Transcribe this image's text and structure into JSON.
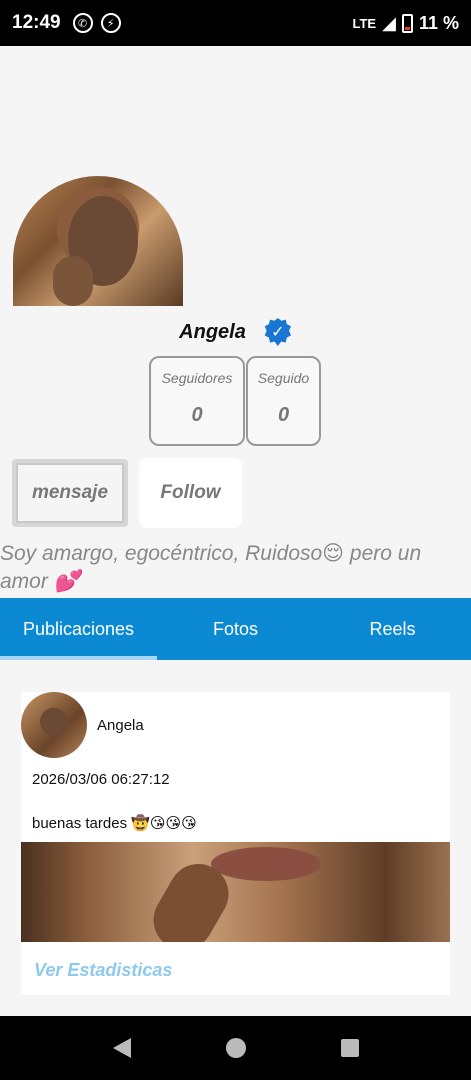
{
  "status_bar": {
    "time": "12:49",
    "battery_text": "11 %",
    "signal_text": "LTE"
  },
  "profile": {
    "name": "Angela",
    "verified": true,
    "followers_label": "Seguidores",
    "followers_value": "0",
    "following_label": "Seguido",
    "following_value": "0",
    "message_button": "mensaje",
    "follow_button": "Follow",
    "bio": "Soy amargo, egocéntrico, Ruidoso😌 pero un amor 💕"
  },
  "tabs": [
    {
      "label": "Publicaciones",
      "active": true
    },
    {
      "label": "Fotos",
      "active": false
    },
    {
      "label": "Reels",
      "active": false
    }
  ],
  "post": {
    "author": "Angela",
    "date": "2026/03/06 06:27:12",
    "text": "buenas tardes 🤠😘😘😘",
    "stats_link": "Ver Estadisticas"
  },
  "colors": {
    "accent": "#0b8ad3",
    "verified": "#1976d2",
    "link": "#8ec9ee"
  }
}
